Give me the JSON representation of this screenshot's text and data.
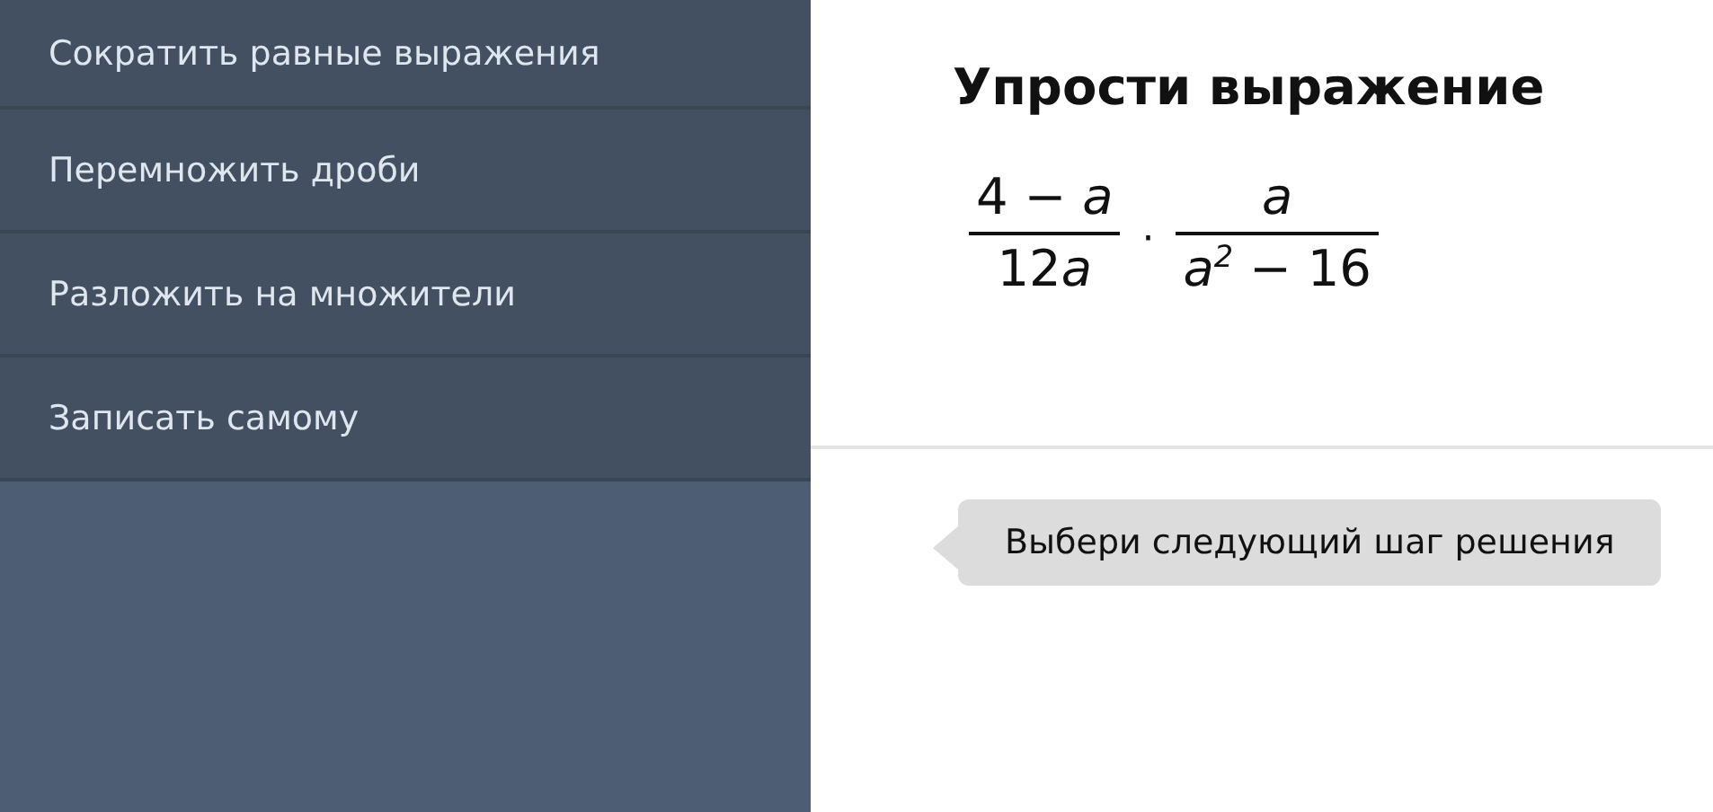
{
  "menu": {
    "items": [
      {
        "label": "Сократить равные выражения"
      },
      {
        "label": "Перемножить дроби"
      },
      {
        "label": "Разложить на множители"
      },
      {
        "label": "Записать самому"
      }
    ]
  },
  "task": {
    "title": "Упрости выражение",
    "expression": {
      "operator": "·",
      "fractions": [
        {
          "numerator": [
            {
              "kind": "number",
              "text": "4 − "
            },
            {
              "kind": "variable",
              "text": "a"
            }
          ],
          "denominator": [
            {
              "kind": "number",
              "text": "12"
            },
            {
              "kind": "variable",
              "text": "a"
            }
          ]
        },
        {
          "numerator": [
            {
              "kind": "variable",
              "text": "a"
            }
          ],
          "denominator": [
            {
              "kind": "variable",
              "text": "a$^{2}$"
            },
            {
              "kind": "number",
              "text": " − 16"
            }
          ]
        }
      ]
    }
  },
  "hint": {
    "text": "Выбери следующий шаг решения"
  }
}
